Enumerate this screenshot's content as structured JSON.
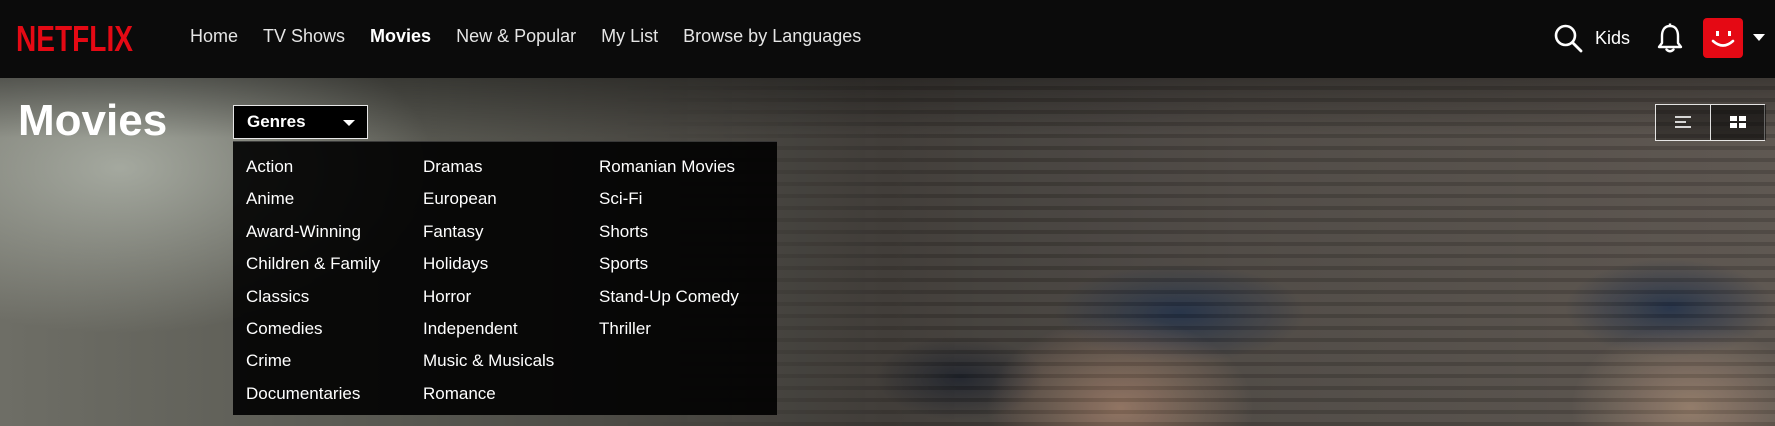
{
  "brand": {
    "logo_text": "NETFLIX",
    "color": "#e50914"
  },
  "nav": {
    "links": [
      {
        "label": "Home"
      },
      {
        "label": "TV Shows"
      },
      {
        "label": "Movies",
        "active": true
      },
      {
        "label": "New & Popular"
      },
      {
        "label": "My List"
      },
      {
        "label": "Browse by Languages"
      }
    ],
    "kids_label": "Kids",
    "icons": {
      "search": "search-icon",
      "notifications": "bell-icon",
      "profile": "avatar",
      "profile_menu": "caret-down-icon"
    }
  },
  "page": {
    "title": "Movies"
  },
  "genres": {
    "button_label": "Genres",
    "columns": [
      [
        "Action",
        "Anime",
        "Award-Winning",
        "Children & Family",
        "Classics",
        "Comedies",
        "Crime",
        "Documentaries"
      ],
      [
        "Dramas",
        "European",
        "Fantasy",
        "Holidays",
        "Horror",
        "Independent",
        "Music & Musicals",
        "Romance"
      ],
      [
        "Romanian Movies",
        "Sci-Fi",
        "Shorts",
        "Sports",
        "Stand-Up Comedy",
        "Thriller"
      ]
    ]
  },
  "view_toggle": {
    "options": [
      "list-view-icon",
      "grid-view-icon"
    ],
    "selected": "list-view-icon"
  }
}
